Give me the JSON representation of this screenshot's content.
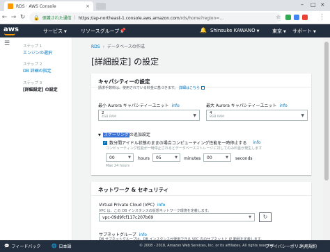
{
  "browser": {
    "tab_title": "RDS · AWS Console",
    "secure_label": "保護された通信",
    "url_host": "https://ap-northeast-1.console.aws.amazon.com",
    "url_path": "/rds/home?region=..."
  },
  "aws_header": {
    "logo": "aws",
    "services": "サービス",
    "resource_groups": "リソースグループ",
    "user": "Shinsuke KAWANO",
    "region": "東京",
    "support": "サポート"
  },
  "sidebar": {
    "steps": [
      {
        "label": "ステップ 1",
        "title": "エンジンの選択"
      },
      {
        "label": "ステップ 2",
        "title": "DB 詳細の指定"
      },
      {
        "label": "ステップ 3",
        "title": "[詳細設定] の設定"
      }
    ]
  },
  "breadcrumb": {
    "root": "RDS",
    "current": "データベースの作成"
  },
  "page_title": "[詳細設定] の設定",
  "capacity": {
    "heading": "キャパシティーの設定",
    "subtitle": "請求手数料は、使用されている料金に基づきます。",
    "details_link": "詳細はこちら",
    "min_label": "最小 Aurora キャパシティーユニット",
    "max_label": "最大 Aurora キャパシティーユニット",
    "info": "info",
    "min_value": "2",
    "min_ram": "4GB RAM",
    "max_value": "4",
    "max_ram": "8GB RAM",
    "scaling_highlight": "スケーリング",
    "scaling_rest": "の追加設定",
    "pause_label": "数分間アイドル状態のままの場合コンピューティング性能を一時停止する",
    "pause_hint": "コンピューティング性能が一時停止されるとデータベースストレージに対してのみ料金が発生します",
    "days_value": "00",
    "hours_value": "05",
    "minutes_value": "00",
    "days_unit": "hours",
    "hours_unit": "minutes",
    "minutes_unit": "seconds",
    "max_hint": "Max 24 hours"
  },
  "network": {
    "heading": "ネットワーク & セキュリティ",
    "vpc_label": "Virtual Private Cloud (VPC)",
    "info": "info",
    "vpc_desc": "VPC は、この DB インスタンスの仮想ネットワーク環境を定義します。",
    "vpc_value": "vpc-09d9fcf117c207b69",
    "subnet_label": "サブネットグループ",
    "subnet_desc": "DB サブネットグループは、DB インスタンスが使用できる VPC 内のサブネットと IP 範囲を定義します。"
  },
  "footer": {
    "feedback": "フィードバック",
    "language": "日本語",
    "copyright": "© 2008 - 2018, Amazon Web Services, Inc. or its affiliates. All rights reserved.",
    "privacy": "プライバシーポリシー",
    "terms": "利用規約"
  },
  "colors": {
    "aws_nav": "#232f3e",
    "aws_orange": "#ff9900",
    "link_blue": "#0073bb"
  }
}
